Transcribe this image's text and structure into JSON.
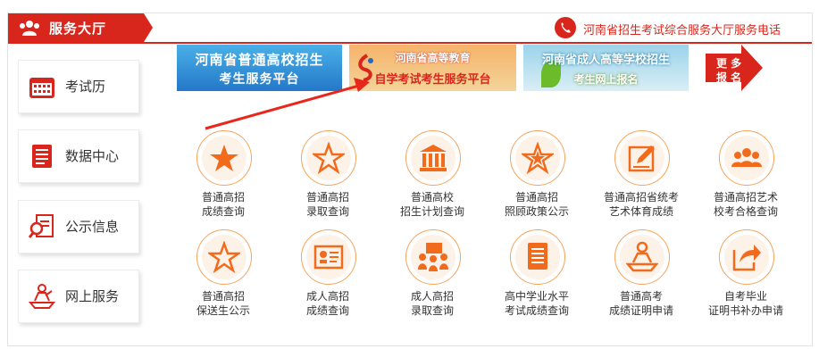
{
  "header": {
    "title": "服务大厅",
    "phone_text": "河南省招生考试综合服务大厅服务电话"
  },
  "sidebar": [
    {
      "label": "考试历"
    },
    {
      "label": "数据中心"
    },
    {
      "label": "公示信息"
    },
    {
      "label": "网上服务"
    }
  ],
  "banners": [
    {
      "line1": "河南省普通高校招生",
      "line2": "考生服务平台"
    },
    {
      "line1": "河南省高等教育",
      "line2": "自学考试考生服务平台"
    },
    {
      "line1": "河南省成人高等学校招生",
      "line2": "考生网上报名"
    }
  ],
  "more": {
    "line1": "更 多",
    "line2": "报 名"
  },
  "services": [
    {
      "line1": "普通高招",
      "line2": "成绩查询",
      "icon": "star-filled-icon"
    },
    {
      "line1": "普通高招",
      "line2": "录取查询",
      "icon": "star-outline-icon"
    },
    {
      "line1": "普通高校",
      "line2": "招生计划查询",
      "icon": "building-icon"
    },
    {
      "line1": "普通高招",
      "line2": "照顾政策公示",
      "icon": "star-badge-icon"
    },
    {
      "line1": "普通高招省统考",
      "line2": "艺术体育成绩",
      "icon": "edit-icon"
    },
    {
      "line1": "普通高招艺术",
      "line2": "校考合格查询",
      "icon": "group-icon"
    },
    {
      "line1": "普通高招",
      "line2": "保送生公示",
      "icon": "star-outline-icon"
    },
    {
      "line1": "成人高招",
      "line2": "成绩查询",
      "icon": "certificate-icon"
    },
    {
      "line1": "成人高招",
      "line2": "录取查询",
      "icon": "meeting-icon"
    },
    {
      "line1": "高中学业水平",
      "line2": "考试成绩查询",
      "icon": "document-icon"
    },
    {
      "line1": "普通高考",
      "line2": "成绩证明申请",
      "icon": "reader-icon"
    },
    {
      "line1": "自考毕业",
      "line2": "证明书补办申请",
      "icon": "share-icon"
    }
  ],
  "colors": {
    "accent": "#d9261c",
    "ring": "#f5a35a",
    "icon": "#f26a1b"
  }
}
